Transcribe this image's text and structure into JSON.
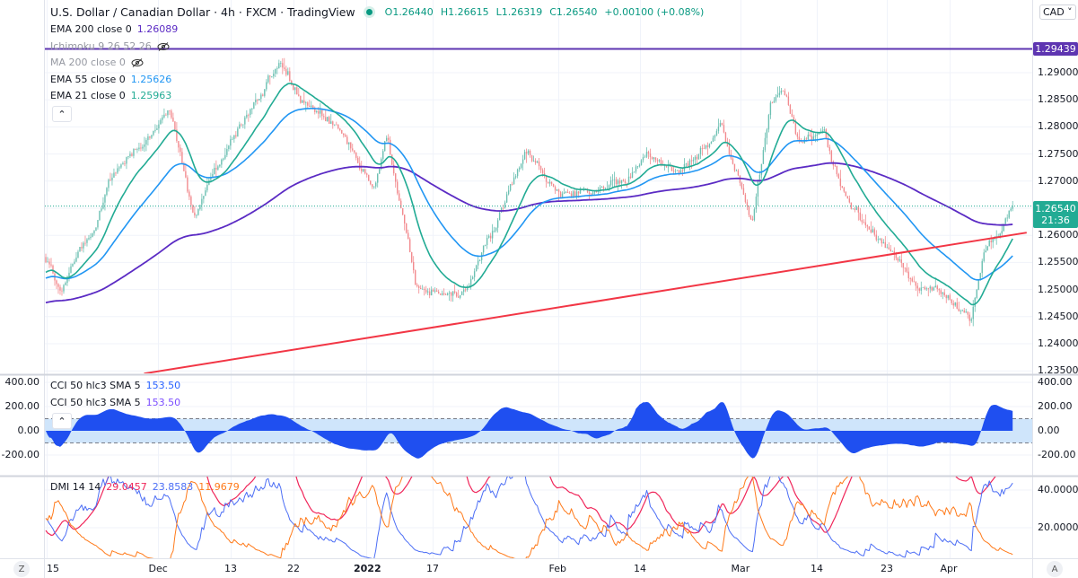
{
  "header": {
    "title": "U.S. Dollar / Canadian Dollar · 4h · FXCM · TradingView",
    "open": "O1.26440",
    "high": "H1.26615",
    "low": "L1.26319",
    "close": "C1.26540",
    "change": "+0.00100 (+0.08%)",
    "currency": "CAD"
  },
  "legends": {
    "ema200": {
      "label": "EMA 200 close 0",
      "value": "1.26089",
      "color": "#5b2bc4"
    },
    "ichimoku": {
      "label": "Ichimoku 9 26 52 26",
      "hidden": true
    },
    "ma200": {
      "label": "MA 200 close 0",
      "hidden": true
    },
    "ema55": {
      "label": "EMA 55 close 0",
      "value": "1.25626",
      "color": "#2196f3"
    },
    "ema21": {
      "label": "EMA 21 close 0",
      "value": "1.25963",
      "color": "#22ab94"
    },
    "cci1": {
      "label": "CCI 50 hlc3 SMA 5",
      "value": "153.50"
    },
    "cci2": {
      "label": "CCI 50 hlc3 SMA 5",
      "value": "153.50"
    },
    "dmi": {
      "label": "DMI 14 14",
      "adx": "29.0457",
      "plus_di": "23.8583",
      "minus_di": "11.9679"
    }
  },
  "price_axis": [
    "1.29000",
    "1.28500",
    "1.28000",
    "1.27500",
    "1.27000",
    "1.26000",
    "1.25500",
    "1.25000",
    "1.24500",
    "1.24000",
    "1.23500"
  ],
  "price_tags": {
    "horizontal_line": "1.29439",
    "last_price": "1.26540",
    "countdown": "21:36"
  },
  "cci_axis": [
    "400.00",
    "200.00",
    "0.00",
    "-200.00"
  ],
  "dmi_axis": [
    "40.0000",
    "20.0000"
  ],
  "time_axis": [
    "15",
    "Dec",
    "13",
    "22",
    "2022",
    "17",
    "Feb",
    "14",
    "Mar",
    "14",
    "23",
    "Apr"
  ],
  "bottom_buttons": {
    "left": "Z",
    "right": "A"
  },
  "colors": {
    "up": "#6cc0b2",
    "down": "#f28b8f",
    "ema200": "#5b2bc4",
    "ema55": "#2196f3",
    "ema21": "#22ab94",
    "trendline": "#f23645",
    "hline": "#5e35b1",
    "cci": "#1f4ff0",
    "cci_band": "#cfe5fb",
    "adx": "#f0265a",
    "plus_di": "#4c6ef5",
    "minus_di": "#ff7a1a"
  },
  "chart_data": {
    "type": "candlestick",
    "symbol": "USDCAD",
    "interval": "4h",
    "ylim": [
      1.2335,
      1.2985
    ],
    "close_path": [
      [
        "2021-11-15",
        1.256
      ],
      [
        "2021-11-17",
        1.25
      ],
      [
        "2021-11-22",
        1.262
      ],
      [
        "2021-11-24",
        1.27
      ],
      [
        "2021-12-01",
        1.28
      ],
      [
        "2021-12-03",
        1.282
      ],
      [
        "2021-12-07",
        1.262
      ],
      [
        "2021-12-10",
        1.27
      ],
      [
        "2021-12-16",
        1.283
      ],
      [
        "2021-12-20",
        1.292
      ],
      [
        "2021-12-23",
        1.285
      ],
      [
        "2021-12-28",
        1.28
      ],
      [
        "2021-12-31",
        1.273
      ],
      [
        "2022-01-03",
        1.27
      ],
      [
        "2022-01-06",
        1.278
      ],
      [
        "2022-01-09",
        1.265
      ],
      [
        "2022-01-13",
        1.25
      ],
      [
        "2022-01-18",
        1.249
      ],
      [
        "2022-01-21",
        1.25
      ],
      [
        "2022-01-24",
        1.26
      ],
      [
        "2022-01-28",
        1.275
      ],
      [
        "2022-02-01",
        1.268
      ],
      [
        "2022-02-06",
        1.269
      ],
      [
        "2022-02-12",
        1.27
      ],
      [
        "2022-02-15",
        1.274
      ],
      [
        "2022-02-20",
        1.272
      ],
      [
        "2022-02-23",
        1.276
      ],
      [
        "2022-02-26",
        1.28
      ],
      [
        "2022-03-01",
        1.27
      ],
      [
        "2022-03-03",
        1.262
      ],
      [
        "2022-03-06",
        1.283
      ],
      [
        "2022-03-08",
        1.288
      ],
      [
        "2022-03-11",
        1.278
      ],
      [
        "2022-03-15",
        1.28
      ],
      [
        "2022-03-17",
        1.27
      ],
      [
        "2022-03-20",
        1.262
      ],
      [
        "2022-03-23",
        1.258
      ],
      [
        "2022-03-26",
        1.253
      ],
      [
        "2022-03-30",
        1.25
      ],
      [
        "2022-04-01",
        1.249
      ],
      [
        "2022-04-04",
        1.244
      ],
      [
        "2022-04-06",
        1.258
      ],
      [
        "2022-04-08",
        1.26
      ],
      [
        "2022-04-10",
        1.2654
      ]
    ],
    "horizontal_line": 1.29439,
    "trendline": [
      [
        "2021-11-29",
        1.2345
      ],
      [
        "2022-04-12",
        1.2605
      ]
    ],
    "indicators": [
      "EMA 21",
      "EMA 55",
      "EMA 200",
      "CCI 50 hlc3 SMA 5",
      "DMI 14 14"
    ],
    "cci_band": [
      -100,
      100
    ],
    "cci_ylim": [
      -300,
      450
    ],
    "dmi_ylim": [
      0,
      45
    ]
  }
}
